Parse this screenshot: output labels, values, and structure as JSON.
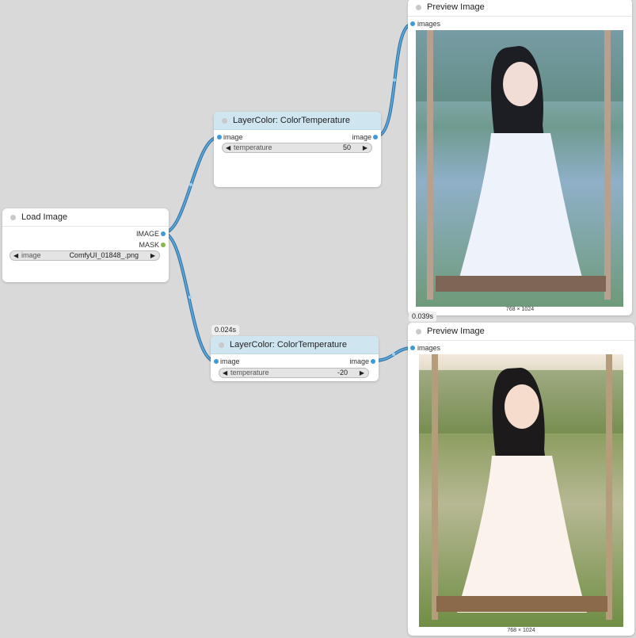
{
  "load_image": {
    "title": "Load Image",
    "outputs": [
      "IMAGE",
      "MASK"
    ],
    "widget_label": "image",
    "widget_value": "ComfyUI_01848_.png"
  },
  "color_temp_1": {
    "title": "LayerColor: ColorTemperature",
    "input": "image",
    "output": "image",
    "widget_label": "temperature",
    "widget_value": "50"
  },
  "color_temp_2": {
    "badge": "0.024s",
    "title": "LayerColor: ColorTemperature",
    "input": "image",
    "output": "image",
    "widget_label": "temperature",
    "widget_value": "-20"
  },
  "preview_1": {
    "title": "Preview Image",
    "input": "images",
    "dims": "768 × 1024",
    "badge": "0.039s"
  },
  "preview_2": {
    "title": "Preview Image",
    "input": "images",
    "dims": "768 × 1024"
  },
  "colors": {
    "canvas": "#d9d9d9",
    "wire": "#3f8dc6",
    "port_image": "#3e9bd6",
    "port_mask": "#86b84a",
    "header_highlight": "#cfe6f1"
  }
}
